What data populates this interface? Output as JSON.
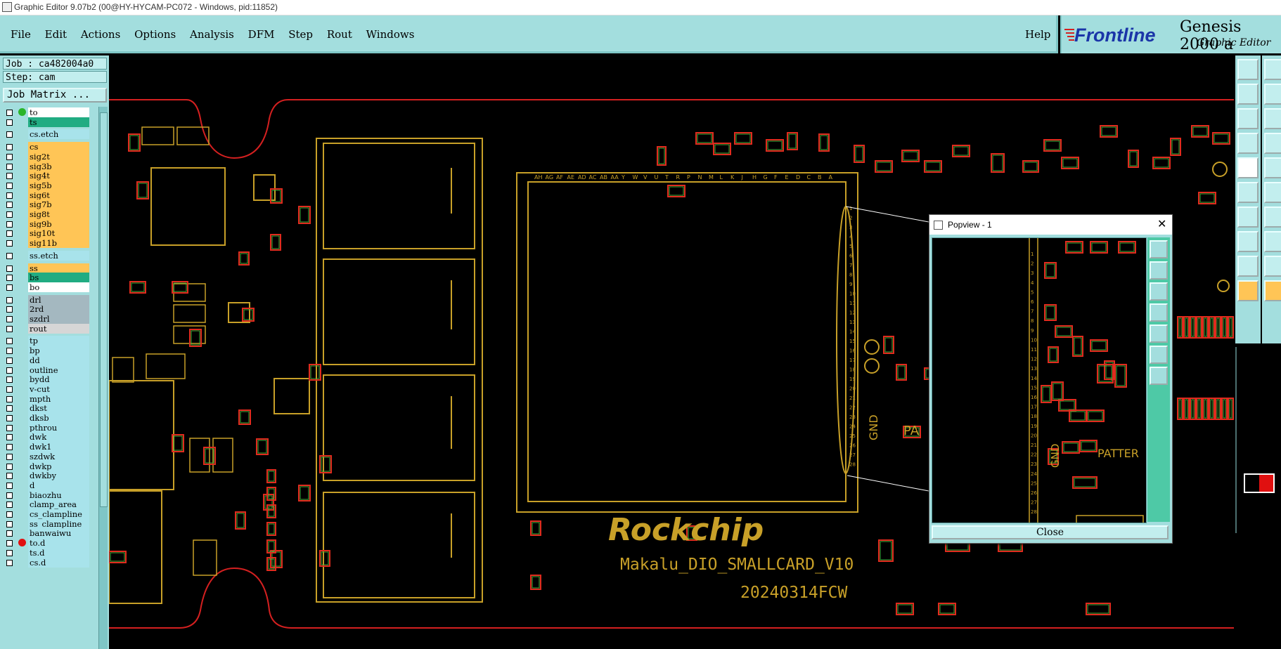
{
  "window": {
    "title": "Graphic Editor 9.07b2 (00@HY-HYCAM-PC072 - Windows, pid:11852)"
  },
  "menu": {
    "items": [
      "File",
      "Edit",
      "Actions",
      "Options",
      "Analysis",
      "DFM",
      "Step",
      "Rout",
      "Windows"
    ],
    "help": "Help"
  },
  "brand": {
    "logo": "Frontline",
    "product": "Genesis 2000",
    "product_suffix": "a",
    "subtitle": "Graphic Editor"
  },
  "job": {
    "job_label": "Job : ca482004a0",
    "step_label": "Step: cam",
    "matrix_button": "Job Matrix ..."
  },
  "layers": [
    {
      "name": "to",
      "color": "sel",
      "dot": "green"
    },
    {
      "name": "ts",
      "color": "green"
    },
    {
      "name": "cs.etch",
      "color": "cyan"
    },
    {
      "name": "cs",
      "color": "orange"
    },
    {
      "name": "sig2t",
      "color": "orange"
    },
    {
      "name": "sig3b",
      "color": "orange"
    },
    {
      "name": "sig4t",
      "color": "orange"
    },
    {
      "name": "sig5b",
      "color": "orange"
    },
    {
      "name": "sig6t",
      "color": "orange"
    },
    {
      "name": "sig7b",
      "color": "orange"
    },
    {
      "name": "sig8t",
      "color": "orange"
    },
    {
      "name": "sig9b",
      "color": "orange"
    },
    {
      "name": "sig10t",
      "color": "orange"
    },
    {
      "name": "sig11b",
      "color": "orange"
    },
    {
      "name": "ss.etch",
      "color": "cyan"
    },
    {
      "name": "ss",
      "color": "orange"
    },
    {
      "name": "bs",
      "color": "green"
    },
    {
      "name": "bo",
      "color": "white"
    },
    {
      "name": "drl",
      "color": "gray"
    },
    {
      "name": "2rd",
      "color": "gray"
    },
    {
      "name": "szdrl",
      "color": "gray"
    },
    {
      "name": "rout",
      "color": "lgray"
    },
    {
      "name": "tp",
      "color": "cyan"
    },
    {
      "name": "bp",
      "color": "cyan"
    },
    {
      "name": "dd",
      "color": "cyan"
    },
    {
      "name": "outline",
      "color": "cyan"
    },
    {
      "name": "bydd",
      "color": "cyan"
    },
    {
      "name": "v-cut",
      "color": "cyan"
    },
    {
      "name": "mpth",
      "color": "cyan"
    },
    {
      "name": "dkst",
      "color": "cyan"
    },
    {
      "name": "dksb",
      "color": "cyan"
    },
    {
      "name": "pthrou",
      "color": "cyan"
    },
    {
      "name": "dwk",
      "color": "cyan"
    },
    {
      "name": "dwk1",
      "color": "cyan"
    },
    {
      "name": "szdwk",
      "color": "cyan"
    },
    {
      "name": "dwkp",
      "color": "cyan"
    },
    {
      "name": "dwkby",
      "color": "cyan"
    },
    {
      "name": "d",
      "color": "cyan"
    },
    {
      "name": "biaozhu",
      "color": "cyan"
    },
    {
      "name": "clamp_area",
      "color": "cyan"
    },
    {
      "name": "cs_clampline",
      "color": "cyan"
    },
    {
      "name": "ss_clampline",
      "color": "cyan"
    },
    {
      "name": "banwaiwu",
      "color": "cyan"
    },
    {
      "name": "to.d",
      "color": "cyan",
      "dot": "red"
    },
    {
      "name": "ts.d",
      "color": "cyan"
    },
    {
      "name": "cs.d",
      "color": "cyan"
    }
  ],
  "board": {
    "silk_logo": "Rockchip",
    "silk_name": "Makalu_DIO_SMALLCARD_V10",
    "silk_date": "20240314FCW",
    "gnd": "GND",
    "pa": "PA",
    "row_letters": [
      "AH",
      "AG",
      "AF",
      "AE",
      "AD",
      "AC",
      "AB",
      "AA",
      "Y",
      "W",
      "V",
      "U",
      "T",
      "R",
      "P",
      "N",
      "M",
      "L",
      "K",
      "J",
      "H",
      "G",
      "F",
      "E",
      "D",
      "C",
      "B",
      "A"
    ],
    "col_numbers": [
      "1",
      "2",
      "3",
      "4",
      "5",
      "6",
      "7",
      "8",
      "9",
      "10",
      "11",
      "12",
      "13",
      "14",
      "15",
      "16",
      "17",
      "18",
      "19",
      "20",
      "21",
      "22",
      "23",
      "24",
      "25",
      "26",
      "27",
      "28"
    ]
  },
  "popview": {
    "title": "Popview - 1",
    "close_label": "Close",
    "gnd": "GND",
    "patter": "PATTER"
  },
  "colors": {
    "panel": "#a3dede",
    "trace": "#c8a028",
    "pad_red": "#e02b1e",
    "pad_green": "#46b03a",
    "outline_red": "#d42020"
  }
}
